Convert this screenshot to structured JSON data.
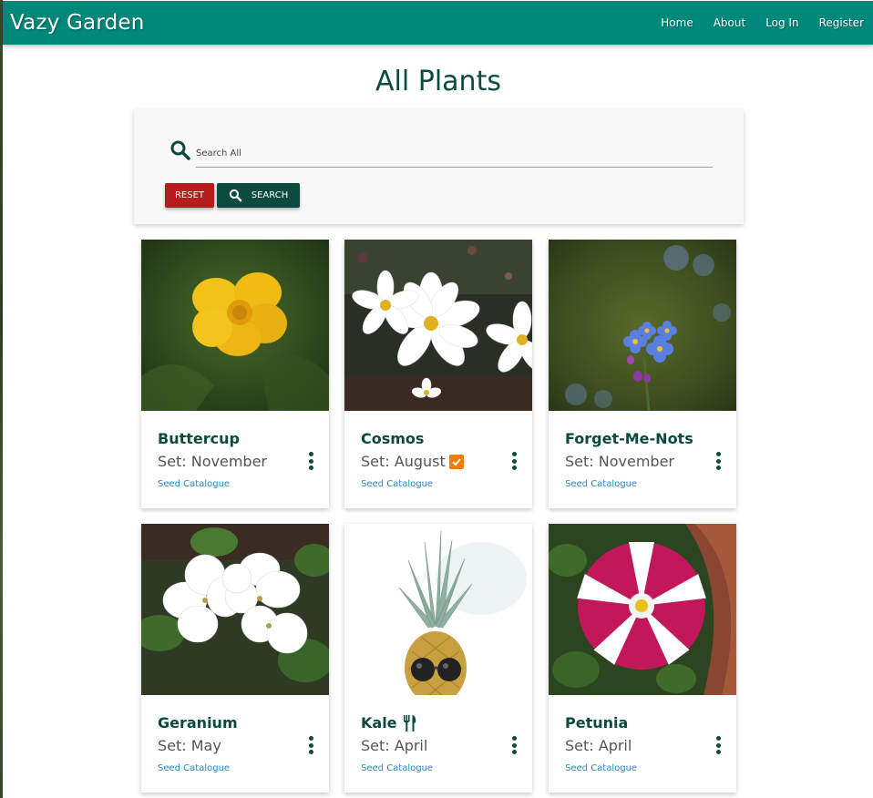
{
  "brand": "Vazy Garden",
  "nav": [
    "Home",
    "About",
    "Log In",
    "Register"
  ],
  "page_title": "All Plants",
  "search": {
    "placeholder": "Search All",
    "reset_label": "RESET",
    "search_label": "SEARCH"
  },
  "colors": {
    "navbar": "#00897b",
    "primary_dark": "#0b4a3e",
    "reset": "#b71c1c",
    "link": "#1e88c9",
    "check_badge": "#f57c00"
  },
  "plants": [
    {
      "name": "Buttercup",
      "set": "Set: November",
      "link": "Seed Catalogue"
    },
    {
      "name": "Cosmos",
      "set": "Set: August",
      "link": "Seed Catalogue",
      "badge": "check-icon"
    },
    {
      "name": "Forget-Me-Nots",
      "set": "Set: November",
      "link": "Seed Catalogue"
    },
    {
      "name": "Geranium",
      "set": "Set: May",
      "link": "Seed Catalogue"
    },
    {
      "name": "Kale",
      "set": "Set: April",
      "link": "Seed Catalogue",
      "badge": "utensils-icon"
    },
    {
      "name": "Petunia",
      "set": "Set: April",
      "link": "Seed Catalogue"
    }
  ]
}
